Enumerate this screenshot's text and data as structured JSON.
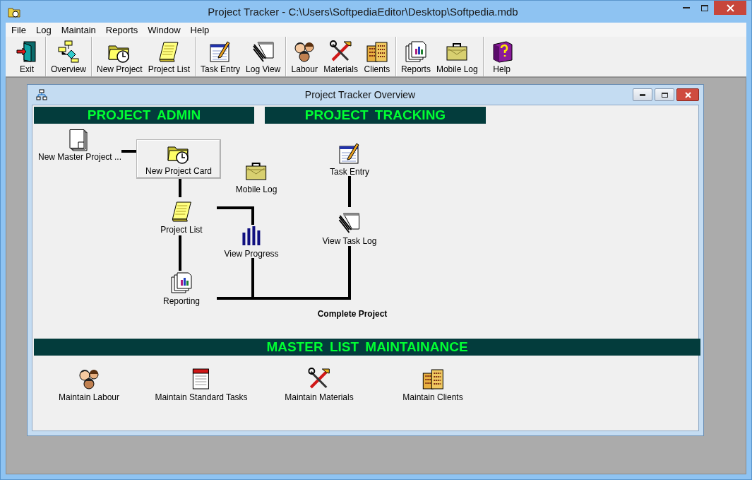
{
  "window": {
    "title": "Project Tracker - C:\\Users\\SoftpediaEditor\\Desktop\\Softpedia.mdb"
  },
  "menu": [
    "File",
    "Log",
    "Maintain",
    "Reports",
    "Window",
    "Help"
  ],
  "toolbar": {
    "groups": [
      [
        {
          "label": "Exit",
          "kind": "exit"
        }
      ],
      [
        {
          "label": "Overview",
          "kind": "flowchart"
        }
      ],
      [
        {
          "label": "New Project",
          "kind": "folder"
        },
        {
          "label": "Project List",
          "kind": "scroll"
        }
      ],
      [
        {
          "label": "Task Entry",
          "kind": "notepad"
        },
        {
          "label": "Log View",
          "kind": "papers"
        }
      ],
      [
        {
          "label": "Labour",
          "kind": "people"
        },
        {
          "label": "Materials",
          "kind": "tools"
        },
        {
          "label": "Clients",
          "kind": "building"
        }
      ],
      [
        {
          "label": "Reports",
          "kind": "reports"
        },
        {
          "label": "Mobile Log",
          "kind": "briefcase"
        }
      ],
      [
        {
          "label": "Help",
          "kind": "book"
        }
      ]
    ]
  },
  "child_window": {
    "title": "Project Tracker Overview",
    "headers": [
      "PROJECT ADMIN",
      "PROJECT TRACKING",
      "MASTER LIST MAINTAINANCE"
    ],
    "nodes": [
      {
        "label": "New Master Project ...",
        "kind": "page",
        "framed": false
      },
      {
        "label": "New Project Card",
        "kind": "folder",
        "framed": true
      },
      {
        "label": "Mobile Log",
        "kind": "briefcase",
        "framed": false
      },
      {
        "label": "Task Entry",
        "kind": "notepad",
        "framed": false
      },
      {
        "label": "Project List",
        "kind": "scroll",
        "framed": false
      },
      {
        "label": "View  Progress",
        "kind": "bars",
        "framed": false
      },
      {
        "label": "View Task Log",
        "kind": "papers",
        "framed": false
      },
      {
        "label": "Reporting",
        "kind": "reports",
        "framed": false
      },
      {
        "label": "Complete Project",
        "kind": "text",
        "framed": false
      },
      {
        "label": "Maintain Labour",
        "kind": "people",
        "framed": false
      },
      {
        "label": "Maintain Standard Tasks",
        "kind": "rednote",
        "framed": false
      },
      {
        "label": "Maintain Materials",
        "kind": "tools",
        "framed": false
      },
      {
        "label": "Maintain Clients",
        "kind": "building",
        "framed": false
      }
    ]
  }
}
